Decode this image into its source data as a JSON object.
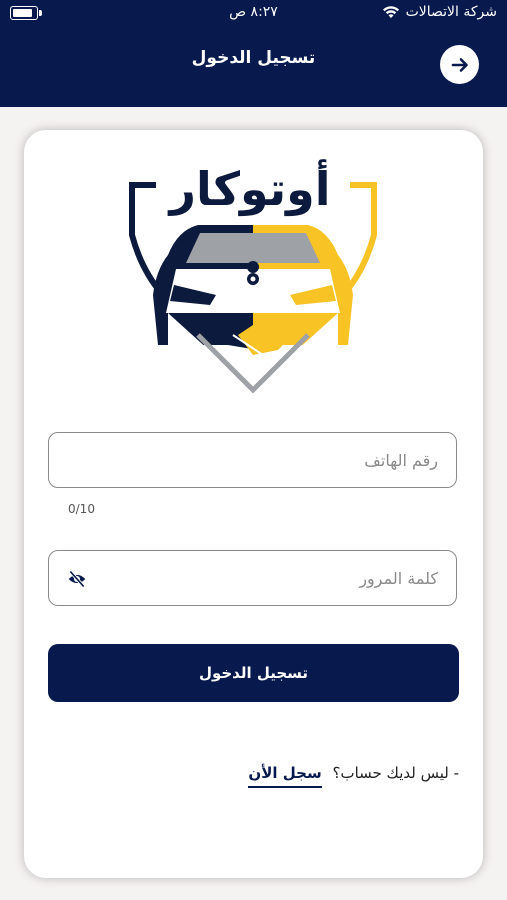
{
  "status_bar": {
    "carrier": "شركة الاتصالات",
    "time": "٨:٢٧ ص",
    "battery_level": 0.85
  },
  "header": {
    "title": "تسجيل الدخول",
    "back_icon": "arrow-right-icon"
  },
  "logo": {
    "text": "أوتوكار",
    "colors": {
      "navy": "#0c1a3d",
      "yellow": "#f7c325",
      "gray": "#9ea1a6"
    }
  },
  "form": {
    "phone_placeholder": "رقم الهاتف",
    "phone_value": "",
    "phone_counter": "0/10",
    "password_placeholder": "كلمة المرور",
    "password_value": "",
    "password_toggle_icon": "eye-off-icon",
    "submit_label": "تسجيل الدخول"
  },
  "signup": {
    "prompt": "- ليس لديك حساب؟",
    "link": "سجل الأن"
  },
  "colors": {
    "primary": "#081a4d",
    "background": "#f5f2f2",
    "card": "#ffffff"
  }
}
